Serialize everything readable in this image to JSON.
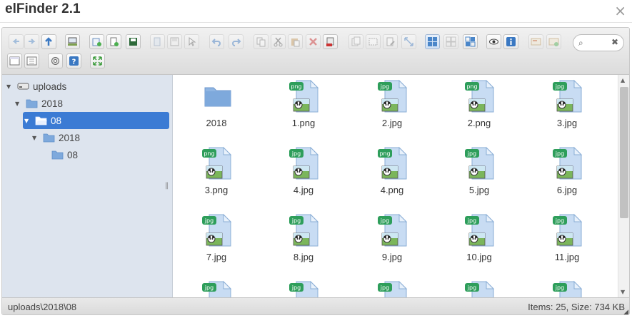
{
  "window": {
    "title": "elFinder 2.1",
    "close_glyph": "×"
  },
  "toolbar": {
    "buttons": [
      {
        "name": "back-icon",
        "enabled": false
      },
      {
        "name": "forward-icon",
        "enabled": false
      },
      {
        "name": "up-icon",
        "enabled": true
      },
      {
        "name": "netmount-icon",
        "enabled": true
      },
      {
        "name": "mkdir-icon",
        "enabled": true
      },
      {
        "name": "mkfile-icon",
        "enabled": true
      },
      {
        "name": "upload-icon",
        "enabled": true
      },
      {
        "name": "open-icon",
        "enabled": false
      },
      {
        "name": "download-icon",
        "enabled": false
      },
      {
        "name": "getfile-icon",
        "enabled": false
      },
      {
        "name": "undo-icon",
        "enabled": false
      },
      {
        "name": "redo-icon",
        "enabled": false
      },
      {
        "name": "copy-icon",
        "enabled": false
      },
      {
        "name": "cut-icon",
        "enabled": false
      },
      {
        "name": "paste-icon",
        "enabled": false
      },
      {
        "name": "delete-icon",
        "enabled": false
      },
      {
        "name": "empty-icon",
        "enabled": true
      },
      {
        "name": "duplicate-icon",
        "enabled": false
      },
      {
        "name": "rename-icon",
        "enabled": false
      },
      {
        "name": "edit-icon",
        "enabled": false
      },
      {
        "name": "resize-icon",
        "enabled": false
      },
      {
        "name": "selectall-icon",
        "enabled": true
      },
      {
        "name": "selectnone-icon",
        "enabled": false
      },
      {
        "name": "selectinvert-icon",
        "enabled": true
      },
      {
        "name": "quicklook-icon",
        "enabled": true
      },
      {
        "name": "info-icon",
        "enabled": true
      },
      {
        "name": "extract-icon",
        "enabled": false
      },
      {
        "name": "archive-icon",
        "enabled": false
      },
      {
        "name": "view-icon",
        "enabled": true
      },
      {
        "name": "sort-icon",
        "enabled": true
      },
      {
        "name": "preferences-icon",
        "enabled": true
      },
      {
        "name": "help-icon",
        "enabled": true
      },
      {
        "name": "fullscreen-icon",
        "enabled": true
      }
    ],
    "search": {
      "placeholder": "",
      "search_glyph": "⌕",
      "clear_glyph": "✖"
    }
  },
  "tree": [
    {
      "label": "uploads",
      "icon": "drive-icon",
      "expanded": true,
      "active": false
    },
    {
      "label": "2018",
      "icon": "folder-icon",
      "expanded": true,
      "active": false
    },
    {
      "label": "08",
      "icon": "folder-open-icon",
      "expanded": true,
      "active": true
    },
    {
      "label": "2018",
      "icon": "folder-icon",
      "expanded": true,
      "active": false
    },
    {
      "label": "08",
      "icon": "folder-icon",
      "expanded": false,
      "active": false
    }
  ],
  "files": [
    {
      "name": "2018",
      "type": "folder"
    },
    {
      "name": "1.png",
      "type": "png"
    },
    {
      "name": "2.jpg",
      "type": "jpg"
    },
    {
      "name": "2.png",
      "type": "png"
    },
    {
      "name": "3.jpg",
      "type": "jpg"
    },
    {
      "name": "3.png",
      "type": "png"
    },
    {
      "name": "4.jpg",
      "type": "jpg"
    },
    {
      "name": "4.png",
      "type": "png"
    },
    {
      "name": "5.jpg",
      "type": "jpg"
    },
    {
      "name": "6.jpg",
      "type": "jpg"
    },
    {
      "name": "7.jpg",
      "type": "jpg"
    },
    {
      "name": "8.jpg",
      "type": "jpg"
    },
    {
      "name": "9.jpg",
      "type": "jpg"
    },
    {
      "name": "10.jpg",
      "type": "jpg"
    },
    {
      "name": "11.jpg",
      "type": "jpg"
    },
    {
      "name": "",
      "type": "jpg"
    },
    {
      "name": "",
      "type": "jpg"
    },
    {
      "name": "",
      "type": "jpg"
    },
    {
      "name": "",
      "type": "jpg"
    },
    {
      "name": "",
      "type": "jpg"
    }
  ],
  "status": {
    "path": "uploads\\2018\\08",
    "summary": "Items: 25, Size: 734 KB"
  },
  "colors": {
    "accent": "#3b7bd4",
    "badge": "#2e9e5b",
    "folder": "#7ea9dc",
    "nav_bg": "#dde4ee"
  }
}
